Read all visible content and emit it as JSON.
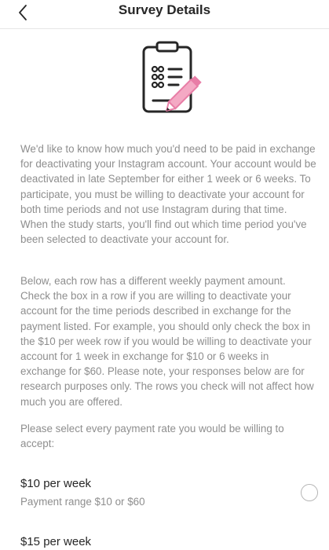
{
  "header": {
    "title": "Survey Details",
    "back_icon": "chevron-left-icon"
  },
  "illustration": {
    "icon": "clipboard-checklist-icon",
    "accent_color": "#e87da6"
  },
  "body": {
    "intro": "We'd like to know how much you'd need to be paid in exchange for deactivating your Instagram account. Your account would be deactivated in late September for either 1 week or 6 weeks. To participate, you must be willing to deactivate your account for both time periods and not use Instagram during that time. When the study starts, you'll find out which time period you've been selected to deactivate your account for.",
    "instructions": "Below, each row has a different weekly payment amount. Check the box in a row if you are willing to deactivate your account for the time periods described in exchange for the payment listed. For example, you should only check the box in the $10 per week row if you would be willing to deactivate your account for 1 week in exchange for $10 or 6 weeks in exchange for $60. Please note, your responses below are for research purposes only. The rows you check will not affect how much you are offered.",
    "prompt": "Please select every payment rate you would be willing to accept:"
  },
  "options": [
    {
      "label": "$10 per week",
      "range": "Payment range $10 or $60",
      "selected": false
    },
    {
      "label": "$15 per week",
      "selected": false
    }
  ]
}
